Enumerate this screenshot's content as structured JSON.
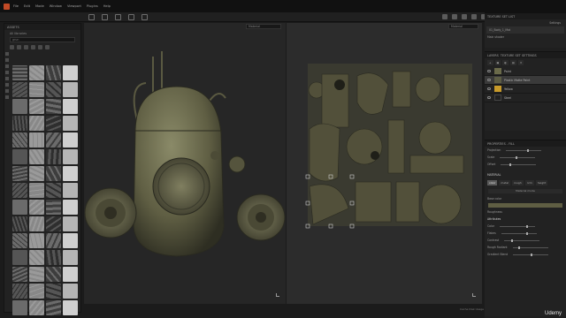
{
  "menu": [
    "File",
    "Edit",
    "Mode",
    "Window",
    "Viewport",
    "Plugins",
    "Help"
  ],
  "assets": {
    "title": "ASSETS",
    "crumb": "All libraries",
    "search_placeholder": "grun"
  },
  "viewport3d": {
    "display_mode": "Material"
  },
  "viewport2d": {
    "display_mode": "Material"
  },
  "texture_set_list": {
    "title": "TEXTURE SET LIST",
    "settings": "Settings",
    "item": "01_Body_1_Mat",
    "shader": "Main shader"
  },
  "layers": {
    "title": "LAYERS",
    "tab": "TEXTURE SET SETTINGS",
    "items": [
      {
        "name": "Paint",
        "color": "#6a6a4a"
      },
      {
        "name": "Plastic Matte Paint",
        "color": "#5c5c44"
      },
      {
        "name": "Yellow",
        "color": "#c79a2a"
      },
      {
        "name": "Steel",
        "color": "#202020"
      }
    ]
  },
  "properties": {
    "title": "PROPERTIES - FILL",
    "rows": [
      "Projection",
      "Scale",
      "Offset"
    ],
    "material_label": "MATERIAL",
    "channels": [
      "color",
      "metal",
      "rough",
      "nrm",
      "height"
    ],
    "material_mode": "Material mode",
    "base_color_label": "Base color",
    "roughness_label": "Roughness",
    "attributes_label": "Attributes",
    "param_rows": [
      "Color",
      "Flakes",
      "Contrast",
      "Rough Radiant",
      "Gradient Blend"
    ]
  },
  "status": {
    "text": "Cache Disk Usage"
  },
  "watermark": "Udemy",
  "colors": {
    "accent": "#c24a26",
    "model": "#5f5e43",
    "uv": "#52503a"
  }
}
